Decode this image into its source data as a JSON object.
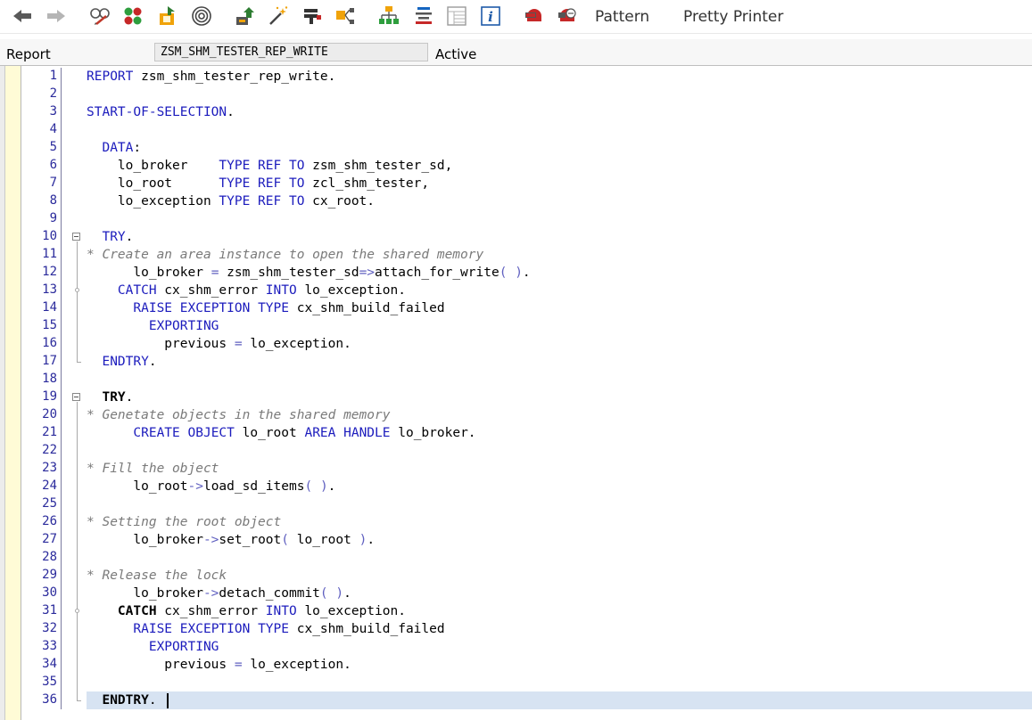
{
  "toolbar": {
    "pattern_label": "Pattern",
    "pretty_printer_label": "Pretty Printer"
  },
  "header": {
    "report_label": "Report",
    "program_name": "ZSM_SHM_TESTER_REP_WRITE",
    "status": "Active"
  },
  "code": {
    "lines": [
      [
        [
          "kw",
          "REPORT"
        ],
        [
          "t",
          " zsm_shm_tester_rep_write."
        ]
      ],
      [],
      [
        [
          "kw",
          "START-OF-SELECTION"
        ],
        [
          "t",
          "."
        ]
      ],
      [],
      [
        [
          "t",
          "  "
        ],
        [
          "kw",
          "DATA"
        ],
        [
          "t",
          ":"
        ]
      ],
      [
        [
          "t",
          "    lo_broker    "
        ],
        [
          "kw",
          "TYPE REF TO"
        ],
        [
          "t",
          " zsm_shm_tester_sd,"
        ]
      ],
      [
        [
          "t",
          "    lo_root      "
        ],
        [
          "kw",
          "TYPE REF TO"
        ],
        [
          "t",
          " zcl_shm_tester,"
        ]
      ],
      [
        [
          "t",
          "    lo_exception "
        ],
        [
          "kw",
          "TYPE REF TO"
        ],
        [
          "t",
          " cx_root."
        ]
      ],
      [],
      [
        [
          "t",
          "  "
        ],
        [
          "kw",
          "TRY"
        ],
        [
          "t",
          "."
        ]
      ],
      [
        [
          "cm",
          "* Create an area instance to open the shared memory"
        ]
      ],
      [
        [
          "t",
          "      lo_broker "
        ],
        [
          "op",
          "="
        ],
        [
          "t",
          " zsm_shm_tester_sd"
        ],
        [
          "op",
          "=>"
        ],
        [
          "t",
          "attach_for_write"
        ],
        [
          "op",
          "("
        ],
        [
          "t",
          " "
        ],
        [
          "op",
          ")"
        ],
        [
          "t",
          "."
        ]
      ],
      [
        [
          "t",
          "    "
        ],
        [
          "kw",
          "CATCH"
        ],
        [
          "t",
          " cx_shm_error "
        ],
        [
          "kw",
          "INTO"
        ],
        [
          "t",
          " lo_exception."
        ]
      ],
      [
        [
          "t",
          "      "
        ],
        [
          "kw",
          "RAISE EXCEPTION TYPE"
        ],
        [
          "t",
          " cx_shm_build_failed"
        ]
      ],
      [
        [
          "t",
          "        "
        ],
        [
          "kw",
          "EXPORTING"
        ]
      ],
      [
        [
          "t",
          "          previous "
        ],
        [
          "op",
          "="
        ],
        [
          "t",
          " lo_exception."
        ]
      ],
      [
        [
          "t",
          "  "
        ],
        [
          "kw",
          "ENDTRY"
        ],
        [
          "t",
          "."
        ]
      ],
      [],
      [
        [
          "t",
          "  "
        ],
        [
          "b",
          "TRY"
        ],
        [
          "t",
          "."
        ]
      ],
      [
        [
          "cm",
          "* Genetate objects in the shared memory"
        ]
      ],
      [
        [
          "t",
          "      "
        ],
        [
          "kw",
          "CREATE OBJECT"
        ],
        [
          "t",
          " lo_root "
        ],
        [
          "kw",
          "AREA HANDLE"
        ],
        [
          "t",
          " lo_broker."
        ]
      ],
      [],
      [
        [
          "cm",
          "* Fill the object"
        ]
      ],
      [
        [
          "t",
          "      lo_root"
        ],
        [
          "op",
          "->"
        ],
        [
          "t",
          "load_sd_items"
        ],
        [
          "op",
          "("
        ],
        [
          "t",
          " "
        ],
        [
          "op",
          ")"
        ],
        [
          "t",
          "."
        ]
      ],
      [],
      [
        [
          "cm",
          "* Setting the root object"
        ]
      ],
      [
        [
          "t",
          "      lo_broker"
        ],
        [
          "op",
          "->"
        ],
        [
          "t",
          "set_root"
        ],
        [
          "op",
          "("
        ],
        [
          "t",
          " lo_root "
        ],
        [
          "op",
          ")"
        ],
        [
          "t",
          "."
        ]
      ],
      [],
      [
        [
          "cm",
          "* Release the lock"
        ]
      ],
      [
        [
          "t",
          "      lo_broker"
        ],
        [
          "op",
          "->"
        ],
        [
          "t",
          "detach_commit"
        ],
        [
          "op",
          "("
        ],
        [
          "t",
          " "
        ],
        [
          "op",
          ")"
        ],
        [
          "t",
          "."
        ]
      ],
      [
        [
          "t",
          "    "
        ],
        [
          "b",
          "CATCH"
        ],
        [
          "t",
          " cx_shm_error "
        ],
        [
          "kw",
          "INTO"
        ],
        [
          "t",
          " lo_exception."
        ]
      ],
      [
        [
          "t",
          "      "
        ],
        [
          "kw",
          "RAISE EXCEPTION TYPE"
        ],
        [
          "t",
          " cx_shm_build_failed"
        ]
      ],
      [
        [
          "t",
          "        "
        ],
        [
          "kw",
          "EXPORTING"
        ]
      ],
      [
        [
          "t",
          "          previous "
        ],
        [
          "op",
          "="
        ],
        [
          "t",
          " lo_exception."
        ]
      ],
      [],
      [
        [
          "t",
          "  "
        ],
        [
          "b",
          "ENDTRY"
        ],
        [
          "t",
          "."
        ]
      ]
    ]
  }
}
